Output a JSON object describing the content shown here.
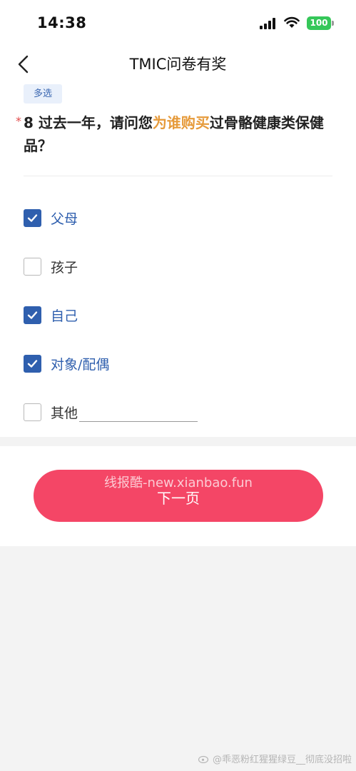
{
  "status_bar": {
    "time": "14:38",
    "battery": "100",
    "icons": [
      "signal-icon",
      "wifi-icon",
      "battery-icon"
    ]
  },
  "nav": {
    "title": "TMIC问卷有奖",
    "back_icon": "chevron-left-icon"
  },
  "question": {
    "type_tag": "多选",
    "required_mark": "*",
    "text_before": "8 过去一年，请问您",
    "text_highlight": "为谁购买",
    "text_after": "过骨骼健康类保健品？",
    "options": [
      {
        "label": "父母",
        "checked": true
      },
      {
        "label": "孩子",
        "checked": false
      },
      {
        "label": "自己",
        "checked": true
      },
      {
        "label": "对象/配偶",
        "checked": true
      },
      {
        "label": "其他",
        "checked": false,
        "has_input": true,
        "input_value": ""
      }
    ]
  },
  "footer": {
    "watermark": "线报酷-new.xianbao.fun",
    "next_label": "下一页"
  },
  "corner_watermark": "@乖恶粉红猩猩绿豆__彻底没招啦",
  "colors": {
    "accent_blue": "#2f5fae",
    "highlight_orange": "#e69a3a",
    "button_red": "#f44666",
    "battery_green": "#35c759",
    "required_red": "#e24b4b"
  }
}
